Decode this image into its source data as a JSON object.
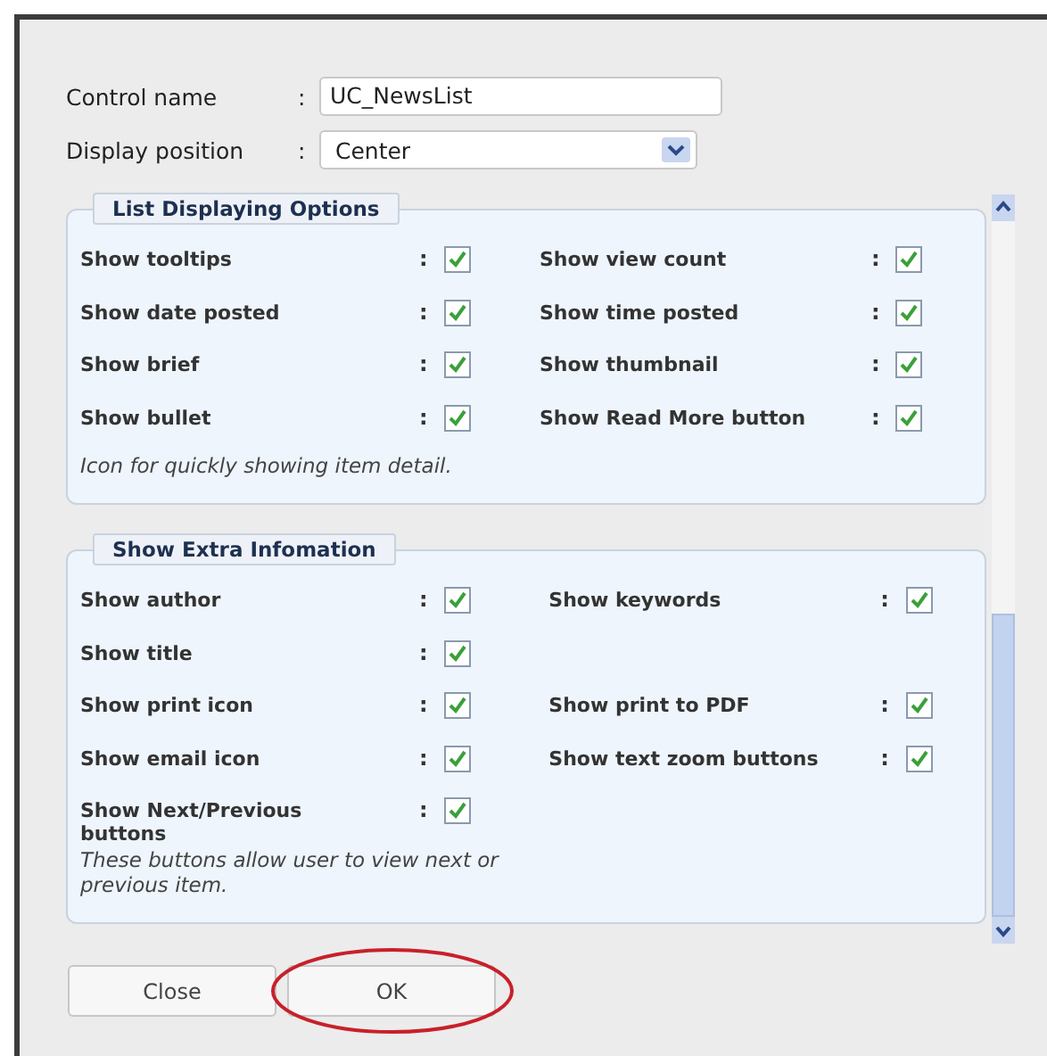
{
  "form": {
    "fields": [
      {
        "label": "Control name",
        "sep": ":",
        "kind": "text",
        "value": "UC_NewsList"
      },
      {
        "label": "Display position",
        "sep": ":",
        "kind": "select",
        "value": "Center"
      }
    ]
  },
  "groups": [
    {
      "legend": "List Displaying Options",
      "rows": [
        [
          {
            "label": "Show tooltips",
            "sep": ":",
            "checked": true
          },
          {
            "label": "Show view count",
            "sep": ":",
            "checked": true
          }
        ],
        [
          {
            "label": "Show date posted",
            "sep": ":",
            "checked": true
          },
          {
            "label": "Show time posted",
            "sep": ":",
            "checked": true
          }
        ],
        [
          {
            "label": "Show brief",
            "sep": ":",
            "checked": true
          },
          {
            "label": "Show thumbnail",
            "sep": ":",
            "checked": true
          }
        ],
        [
          {
            "label": "Show bullet",
            "sep": ":",
            "checked": true
          },
          {
            "label": "Show Read More button",
            "sep": ":",
            "checked": true
          }
        ]
      ],
      "note": "Icon for quickly showing item detail."
    },
    {
      "legend": "Show Extra Infomation",
      "rows": [
        [
          {
            "label": "Show author",
            "sep": ":",
            "checked": true
          },
          {
            "label": "Show keywords",
            "sep": ":",
            "checked": true
          }
        ],
        [
          {
            "label": "Show title",
            "sep": ":",
            "checked": true
          }
        ],
        [
          {
            "label": "Show print icon",
            "sep": ":",
            "checked": true
          },
          {
            "label": "Show print to PDF",
            "sep": ":",
            "checked": true
          }
        ],
        [
          {
            "label": "Show email icon",
            "sep": ":",
            "checked": true
          },
          {
            "label": "Show text zoom buttons",
            "sep": ":",
            "checked": true
          }
        ],
        [
          {
            "label": "Show Next/Previous buttons",
            "sep": ":",
            "checked": true
          }
        ]
      ],
      "note": "These buttons allow user to view next or previous item."
    }
  ],
  "buttons": [
    {
      "label": "Close",
      "highlighted": false
    },
    {
      "label": "OK",
      "highlighted": true
    }
  ]
}
